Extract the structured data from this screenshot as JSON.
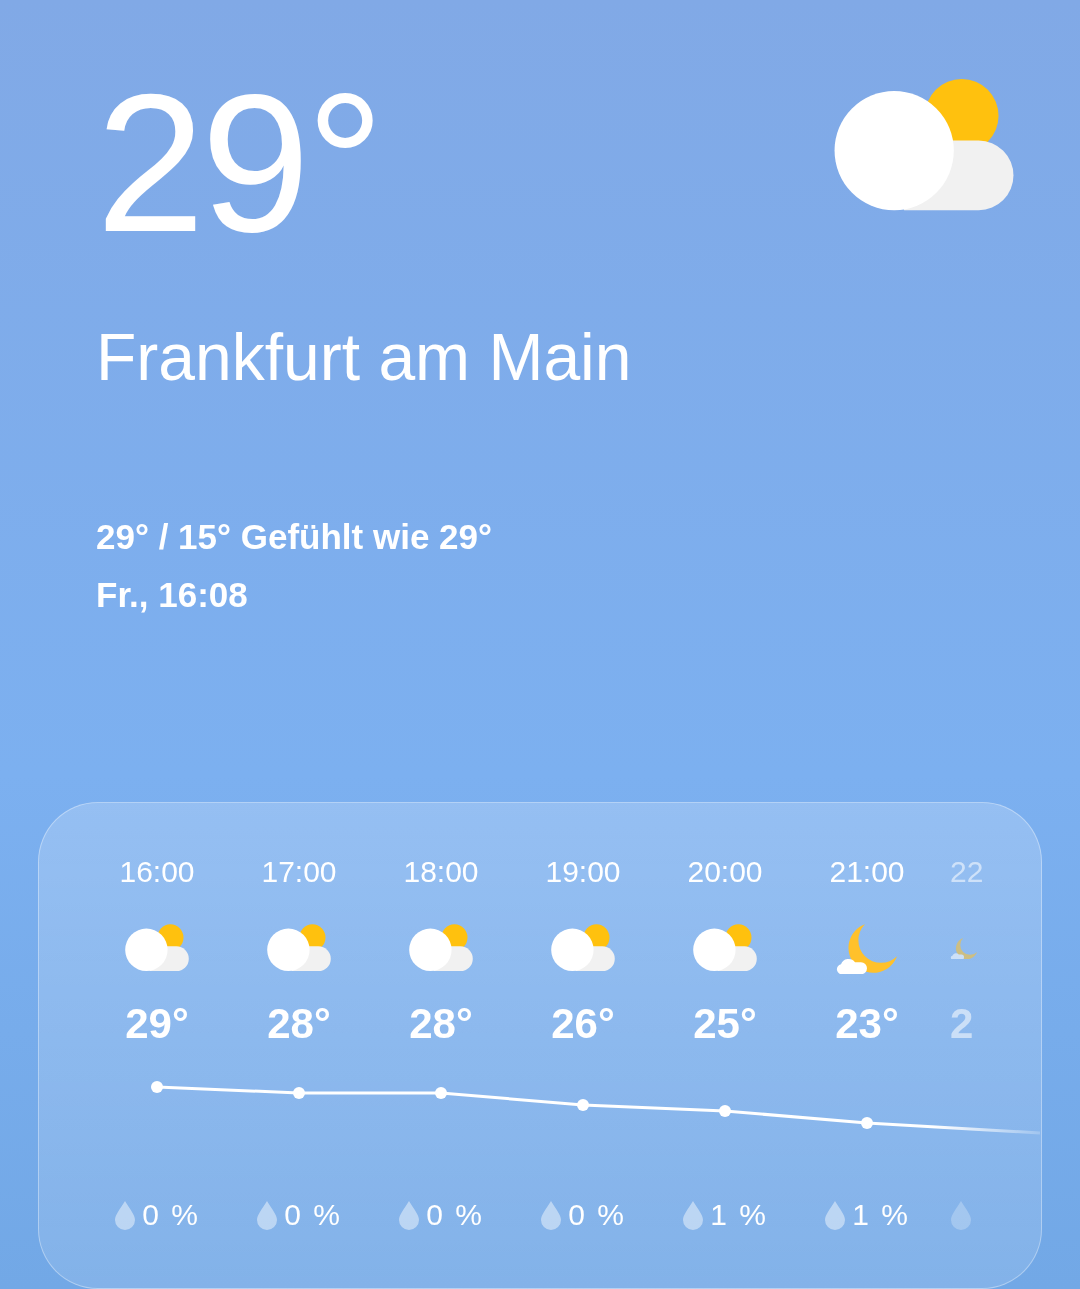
{
  "current": {
    "temperature": "29°",
    "kind": "partly-cloudy",
    "city": "Frankfurt am Main",
    "summary": "29° / 15° Gefühlt wie 29°",
    "datetime": "Fr., 16:08"
  },
  "hourly": [
    {
      "time": "16:00",
      "kind": "partly-cloudy",
      "temperature": "29°",
      "precipitation": "0 %"
    },
    {
      "time": "17:00",
      "kind": "partly-cloudy",
      "temperature": "28°",
      "precipitation": "0 %"
    },
    {
      "time": "18:00",
      "kind": "partly-cloudy",
      "temperature": "28°",
      "precipitation": "0 %"
    },
    {
      "time": "19:00",
      "kind": "partly-cloudy",
      "temperature": "26°",
      "precipitation": "0 %"
    },
    {
      "time": "20:00",
      "kind": "partly-cloudy",
      "temperature": "25°",
      "precipitation": "1 %"
    },
    {
      "time": "21:00",
      "kind": "night-cloudy",
      "temperature": "23°",
      "precipitation": "1 %"
    },
    {
      "time": "22",
      "kind": "night-cloudy",
      "temperature": "2",
      "partial": true
    }
  ]
}
